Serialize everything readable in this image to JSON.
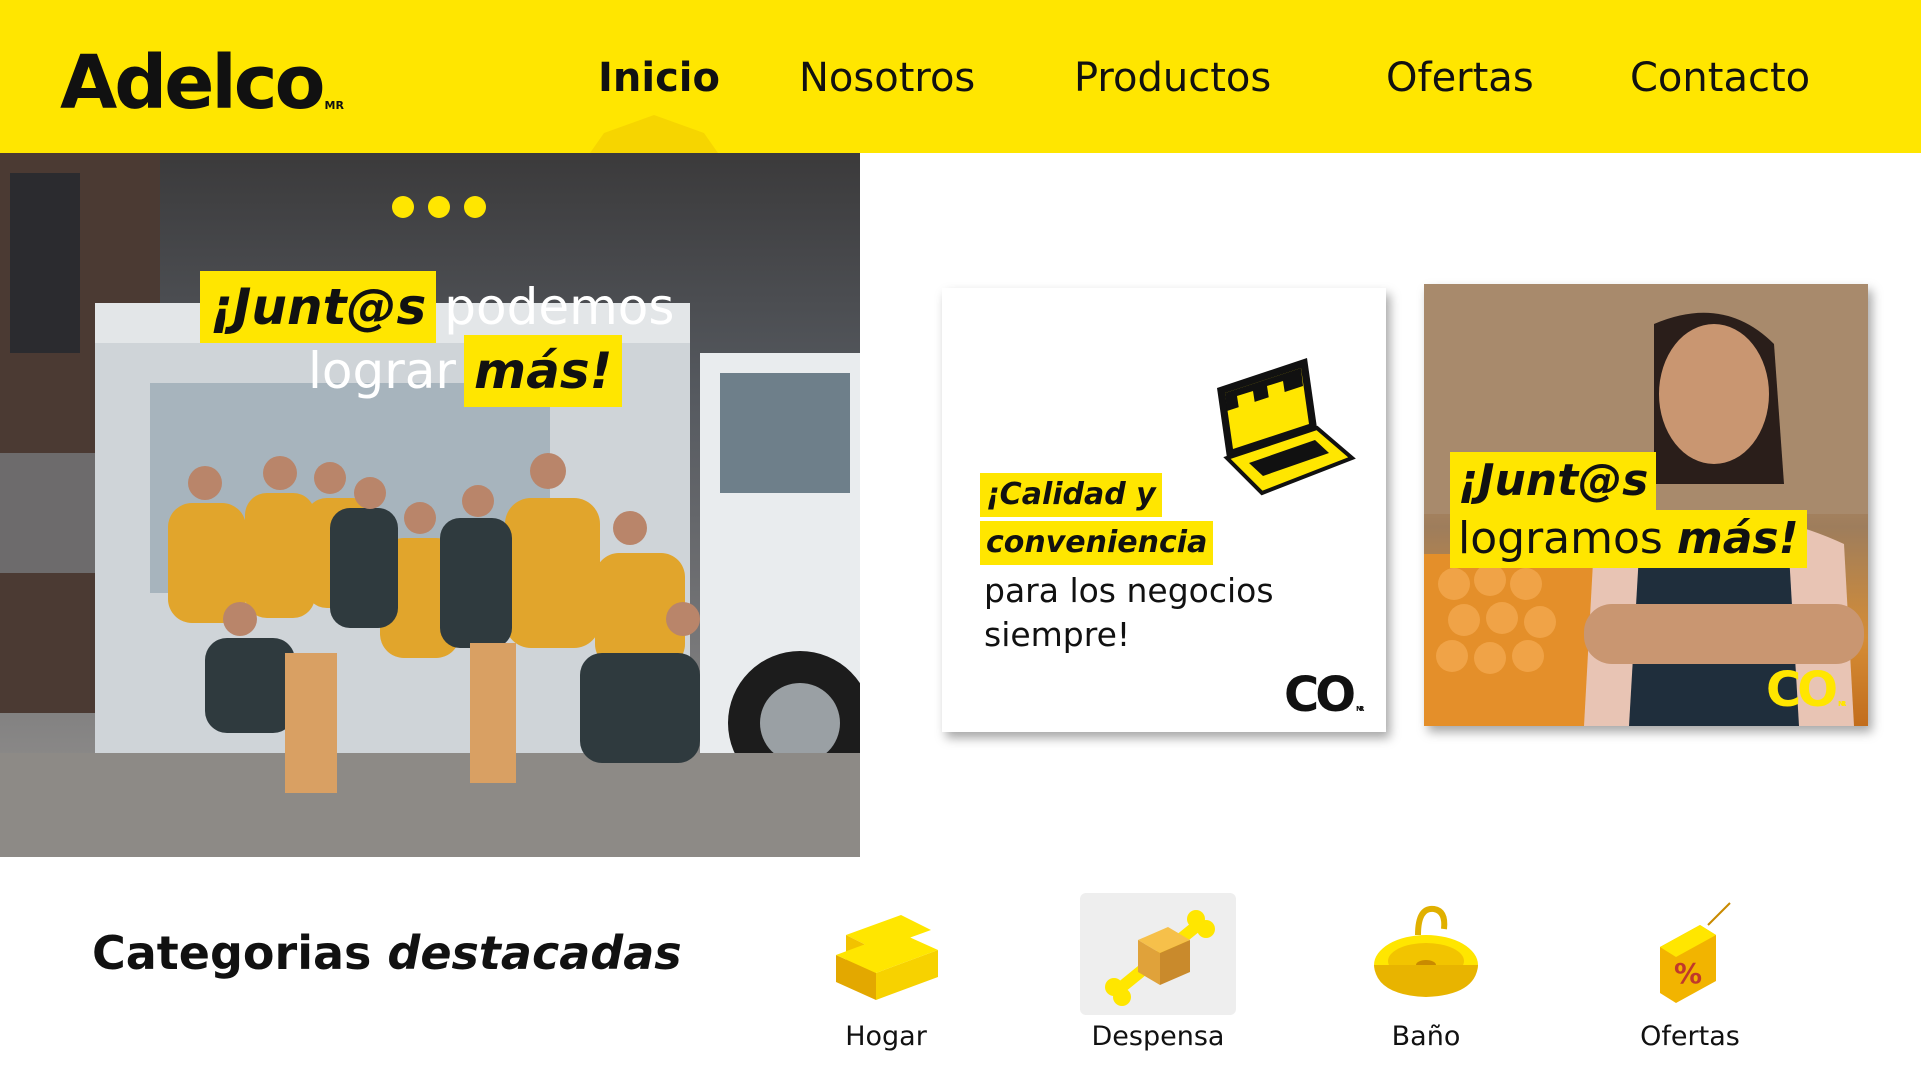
{
  "brand": {
    "logo": "Adelco",
    "mark": "MR",
    "yellow": "#ffe600"
  },
  "nav": {
    "items": [
      "Inicio",
      "Nosotros",
      "Productos",
      "Ofertas",
      "Contacto"
    ],
    "active": "Inicio"
  },
  "hero": {
    "headline_box1": "¡Junt@s",
    "headline_plain1": "podemos",
    "headline_plain2": "lograr",
    "headline_box2": "más!",
    "slide_dots": 3
  },
  "promo_cards": [
    {
      "line1": "¡Calidad y",
      "line2": "conveniencia",
      "line3": "para los negocios",
      "line4": "siempre!",
      "logo": "CO",
      "mark": "MR"
    },
    {
      "line1": "¡Junt@s",
      "line2_plain": "logramos",
      "line2_bold": "más!",
      "logo": "CO",
      "mark": "MR"
    }
  ],
  "categories": {
    "title_plain": "Categorias",
    "title_bold": "destacadas",
    "items": [
      {
        "label": "Hogar",
        "icon": "sofa-icon"
      },
      {
        "label": "Despensa",
        "icon": "bone-box-icon"
      },
      {
        "label": "Baño",
        "icon": "sink-icon"
      },
      {
        "label": "Ofertas",
        "icon": "price-tag-icon"
      }
    ],
    "selected": "Despensa"
  }
}
